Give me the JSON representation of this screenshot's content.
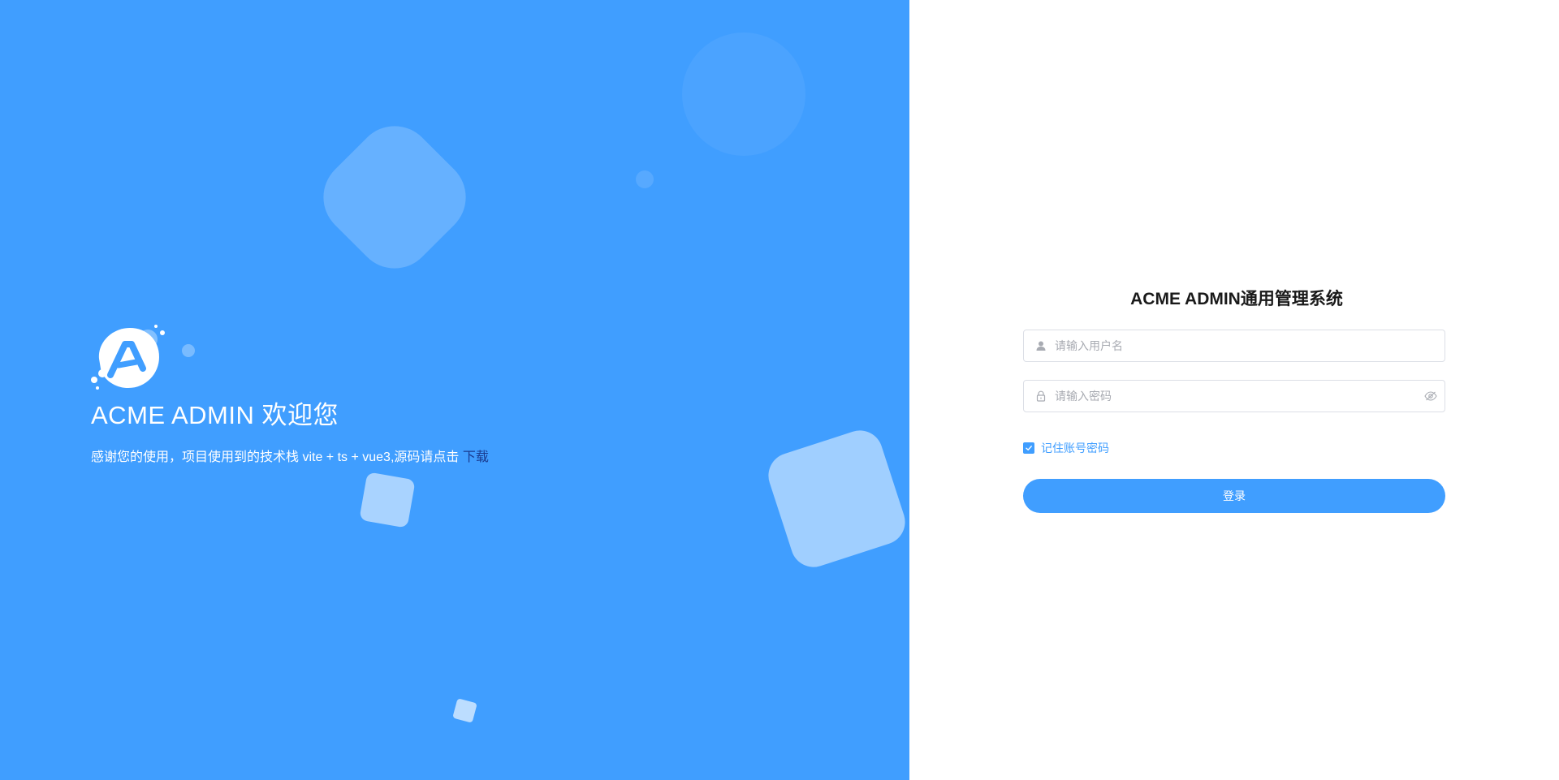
{
  "welcome": {
    "title": "ACME ADMIN 欢迎您",
    "description": "感谢您的使用，项目使用到的技术栈 vite + ts + vue3,源码请点击",
    "download_link": "下载"
  },
  "login": {
    "title": "ACME ADMIN通用管理系统",
    "username_placeholder": "请输入用户名",
    "password_placeholder": "请输入密码",
    "remember_label": "记住账号密码",
    "remember_checked": true,
    "submit_label": "登录"
  },
  "colors": {
    "primary": "#409eff",
    "link": "#1a3b8f",
    "background_right": "#ffffff"
  },
  "icons": {
    "username_prefix": "user-icon",
    "password_prefix": "lock-icon",
    "password_suffix": "eye-off-icon",
    "checkbox": "check-icon"
  }
}
